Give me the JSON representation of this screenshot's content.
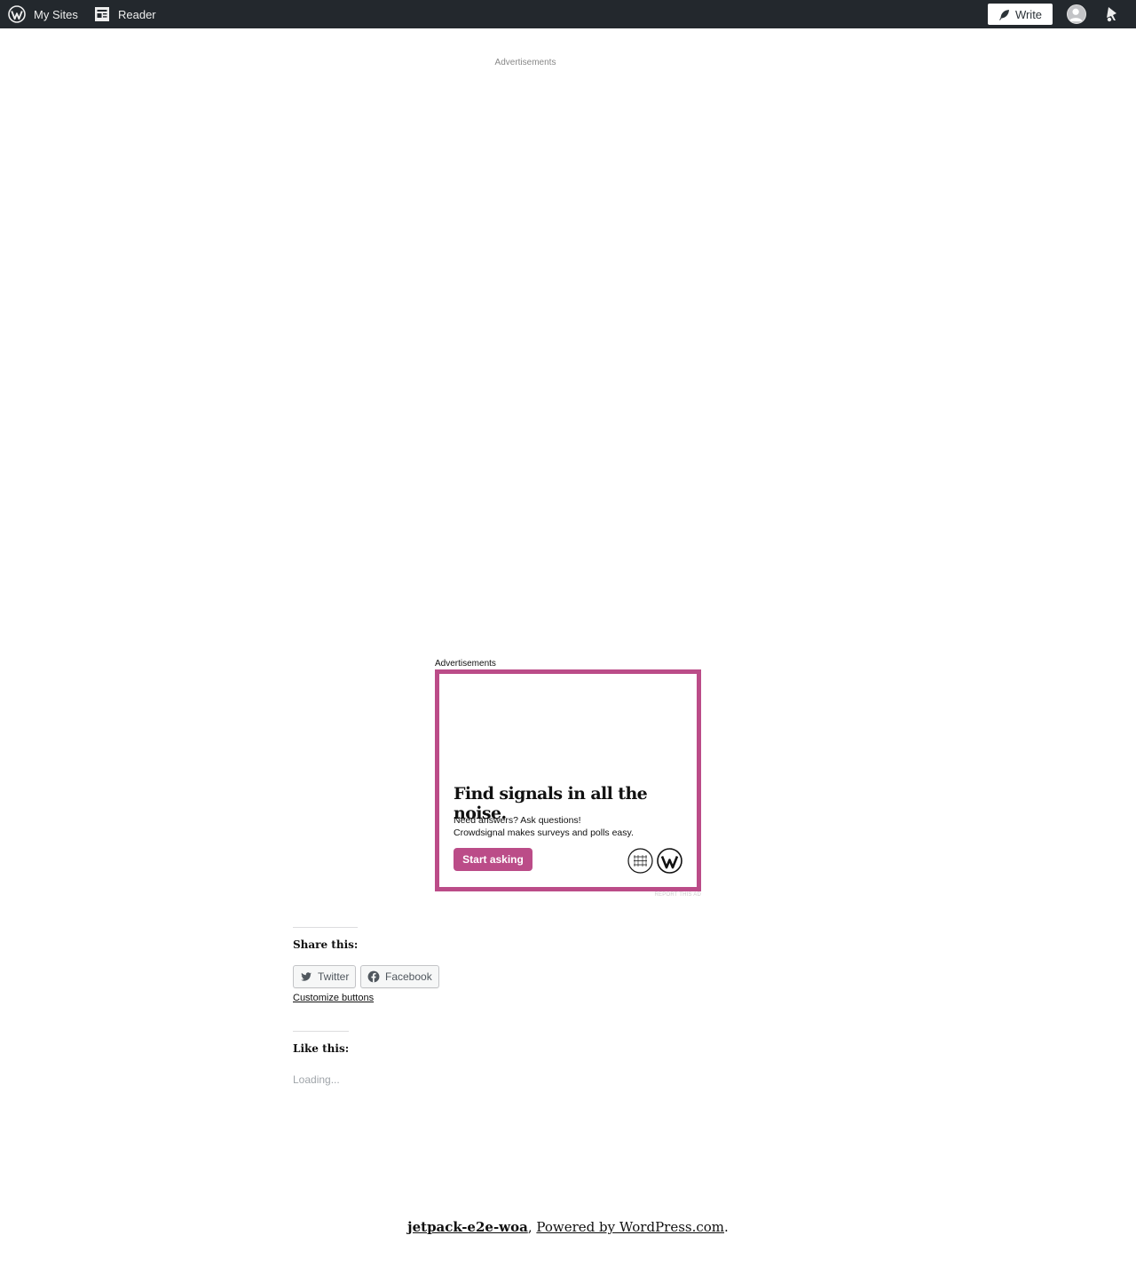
{
  "adminbar": {
    "my_sites_label": "My Sites",
    "reader_label": "Reader",
    "write_label": "Write",
    "background": "#23282d"
  },
  "ads": {
    "top_label": "Advertisements",
    "second_label": "Advertisements",
    "headline": "Find signals in all the noise.",
    "body_line1": "Need answers? Ask questions!",
    "body_line2": "Crowdsignal makes surveys and polls easy.",
    "cta_label": "Start asking",
    "report_label": "REPORT THIS AD",
    "accent": "#bb4c88"
  },
  "sharing": {
    "title": "Share this:",
    "twitter_label": "Twitter",
    "facebook_label": "Facebook",
    "customize_label": "Customize buttons"
  },
  "likes": {
    "title": "Like this:",
    "loading": "Loading..."
  },
  "footer": {
    "site_name": "jetpack-e2e-woa",
    "separator": ",",
    "powered_by": "Powered by WordPress.com",
    "end": "."
  }
}
